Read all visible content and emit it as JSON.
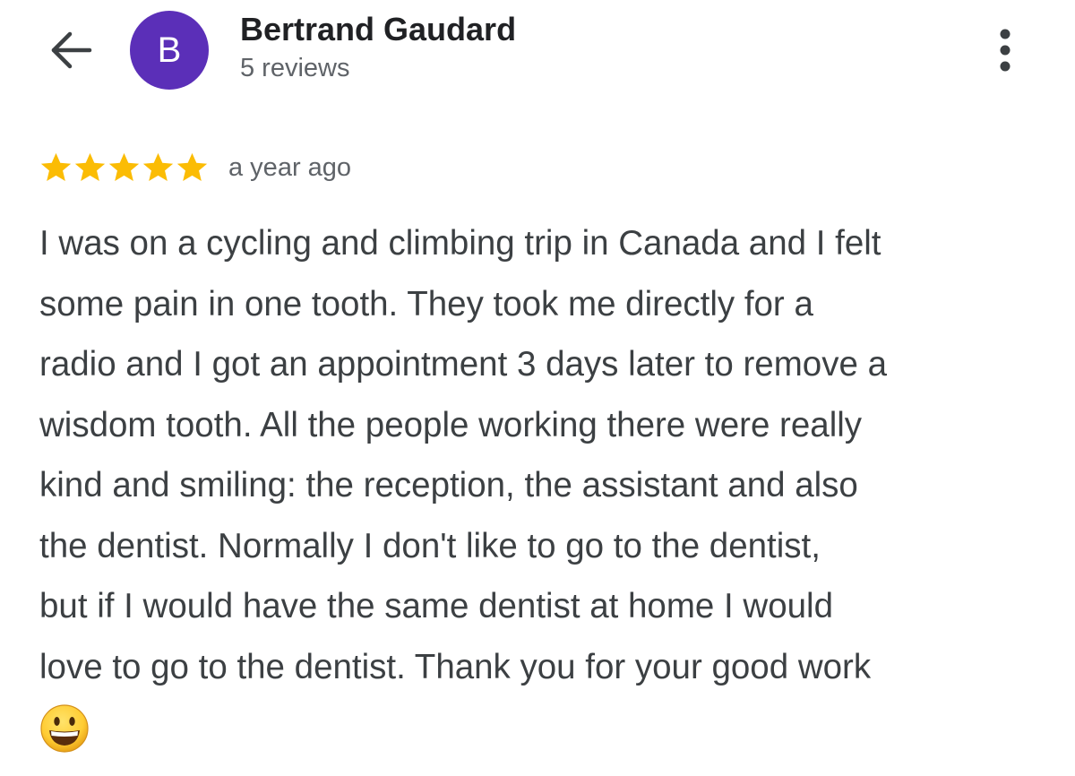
{
  "header": {
    "avatar_letter": "B",
    "reviewer_name": "Bertrand Gaudard",
    "review_count": "5 reviews",
    "back_icon": "arrow-left-icon",
    "more_icon": "vertical-ellipsis-icon"
  },
  "review": {
    "rating": 5,
    "max_rating": 5,
    "time_ago": "a year ago",
    "lines": [
      "I was on a cycling and climbing trip in Canada and I felt",
      "some pain in one tooth. They took me directly for a",
      "radio and I got an appointment 3 days later to remove a",
      "wisdom tooth. All the people working there were really",
      "kind and smiling: the reception, the assistant and also",
      "the dentist. Normally I don't like to go to the dentist,",
      "but if I would have the same dentist at home I would",
      "love to go to the dentist. Thank you for your good work"
    ],
    "emoji_icon": "grinning-face-emoji-icon"
  },
  "colors": {
    "avatar_background": "#5b2fb8",
    "star": "#fbbc04",
    "secondary_text": "#5f6368",
    "body_text": "#3c4043"
  }
}
